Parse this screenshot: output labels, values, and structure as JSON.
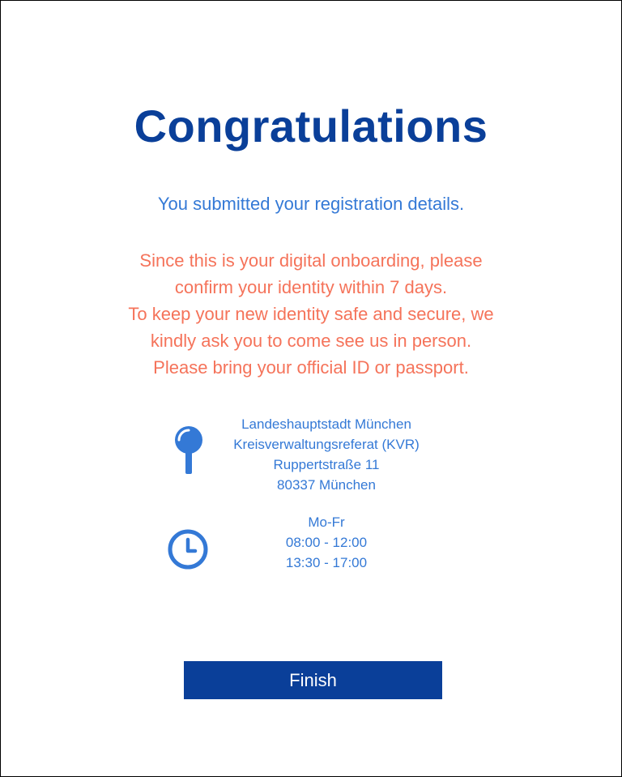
{
  "header": {
    "title": "Congratulations"
  },
  "message": {
    "submitted": "You submitted your registration details.",
    "instructions": [
      "Since this is your digital onboarding, please",
      "confirm your identity within 7 days.",
      "To keep your new identity safe and secure, we",
      "kindly ask you to come see us in person.",
      "Please bring your official ID or passport."
    ]
  },
  "location": {
    "icon": "map-pin-icon",
    "lines": [
      "Landeshauptstadt München",
      "Kreisverwaltungsreferat (KVR)",
      "Ruppertstraße 11",
      "80337 München"
    ]
  },
  "hours": {
    "icon": "clock-icon",
    "lines": [
      "Mo-Fr",
      "08:00 - 12:00",
      "13:30 -  17:00"
    ]
  },
  "actions": {
    "finish_label": "Finish"
  },
  "colors": {
    "title": "#0a3f99",
    "accent": "#3479d6",
    "warning": "#f5735a",
    "button_bg": "#0a3f99",
    "button_text": "#ffffff"
  }
}
